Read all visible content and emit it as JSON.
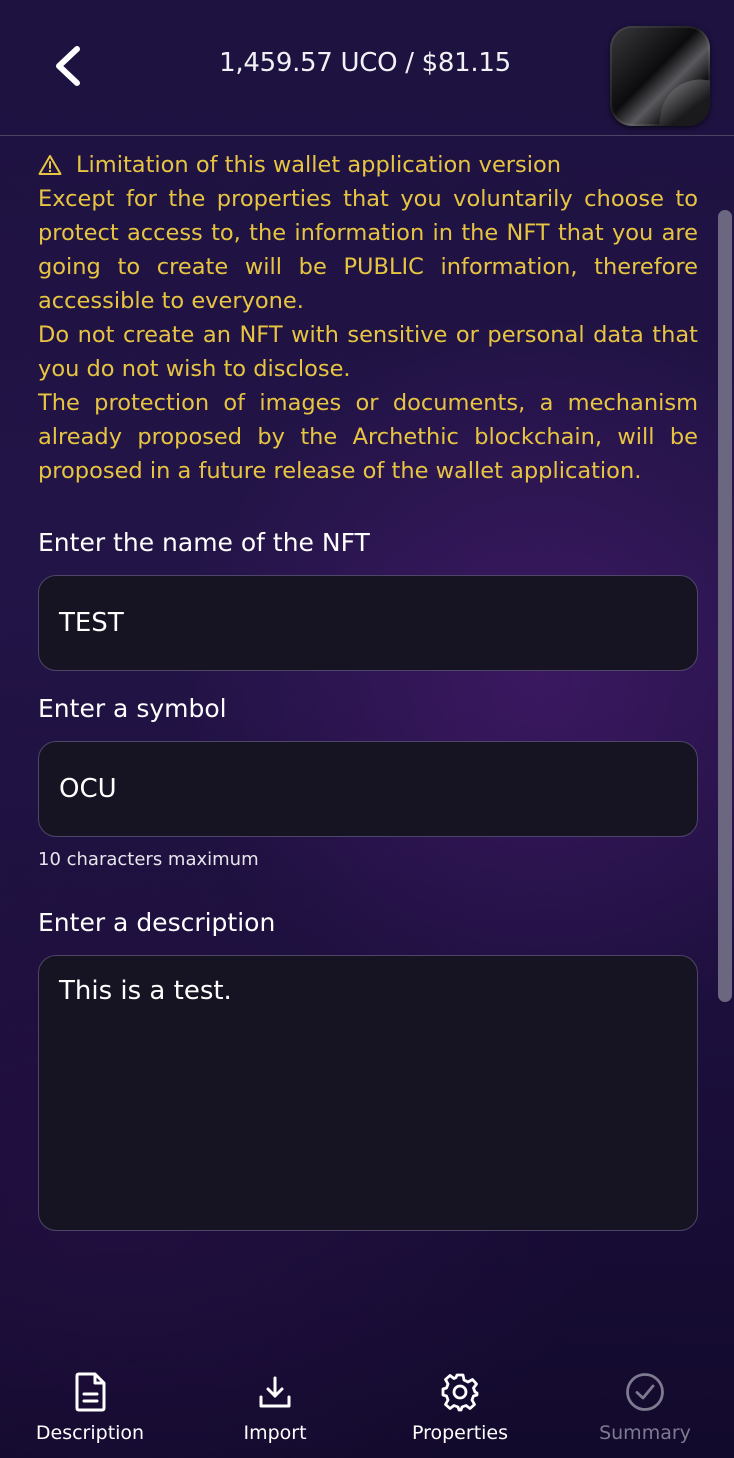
{
  "header": {
    "balance": "1,459.57 UCO / $81.15",
    "back_icon": "chevron-left-icon",
    "avatar_icon": "nft-avatar"
  },
  "warning": {
    "icon": "warning-triangle-icon",
    "color": "#e7c542",
    "title": "Limitation of this wallet application version",
    "paragraphs": [
      "Except for the properties that you voluntarily choose to protect access to, the information in the NFT that you are going to create will be PUBLIC information, therefore accessible to everyone.",
      "Do not create an NFT with sensitive or personal data that you do not wish to disclose.",
      "The protection of images or documents, a mechanism already proposed by the Archethic blockchain, will be proposed in a future release of the wallet application."
    ]
  },
  "form": {
    "name_label": "Enter the name of the NFT",
    "name_value": "TEST",
    "symbol_label": "Enter a symbol",
    "symbol_value": "OCU",
    "symbol_hint": "10 characters maximum",
    "description_label": "Enter a description",
    "description_value": "This is a test."
  },
  "nav": {
    "items": [
      {
        "label": "Description",
        "icon": "document-icon",
        "enabled": true
      },
      {
        "label": "Import",
        "icon": "download-icon",
        "enabled": true
      },
      {
        "label": "Properties",
        "icon": "gear-icon",
        "enabled": true
      },
      {
        "label": "Summary",
        "icon": "check-circle-icon",
        "enabled": false
      }
    ]
  }
}
